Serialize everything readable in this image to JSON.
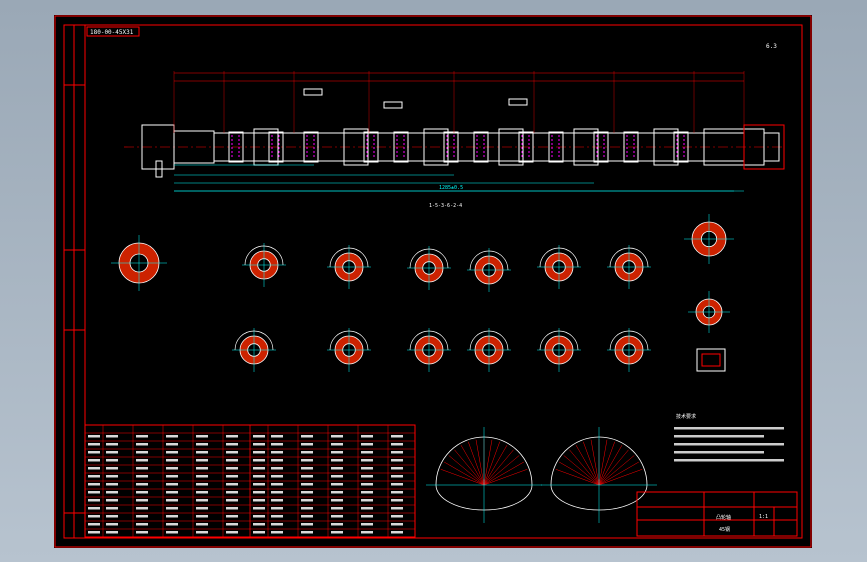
{
  "drawing": {
    "code_box": "180-00-45X31",
    "view_note": "A-A",
    "roughness": "6.3",
    "phase_note": "1-5-3-6-2-4",
    "bottom_length": "1285±0.5",
    "table_header_left": "参数",
    "table_header_right": "参数",
    "tech_req_title": "技术要求",
    "title_block": {
      "name": "凸轮轴",
      "scale": "1:1",
      "material": "45钢"
    }
  },
  "colors": {
    "frame": "#ff0000",
    "shaft": "#ffffff",
    "dim": "#00ffff",
    "hatch": "#ff00ff",
    "fill": "#cc2200"
  }
}
